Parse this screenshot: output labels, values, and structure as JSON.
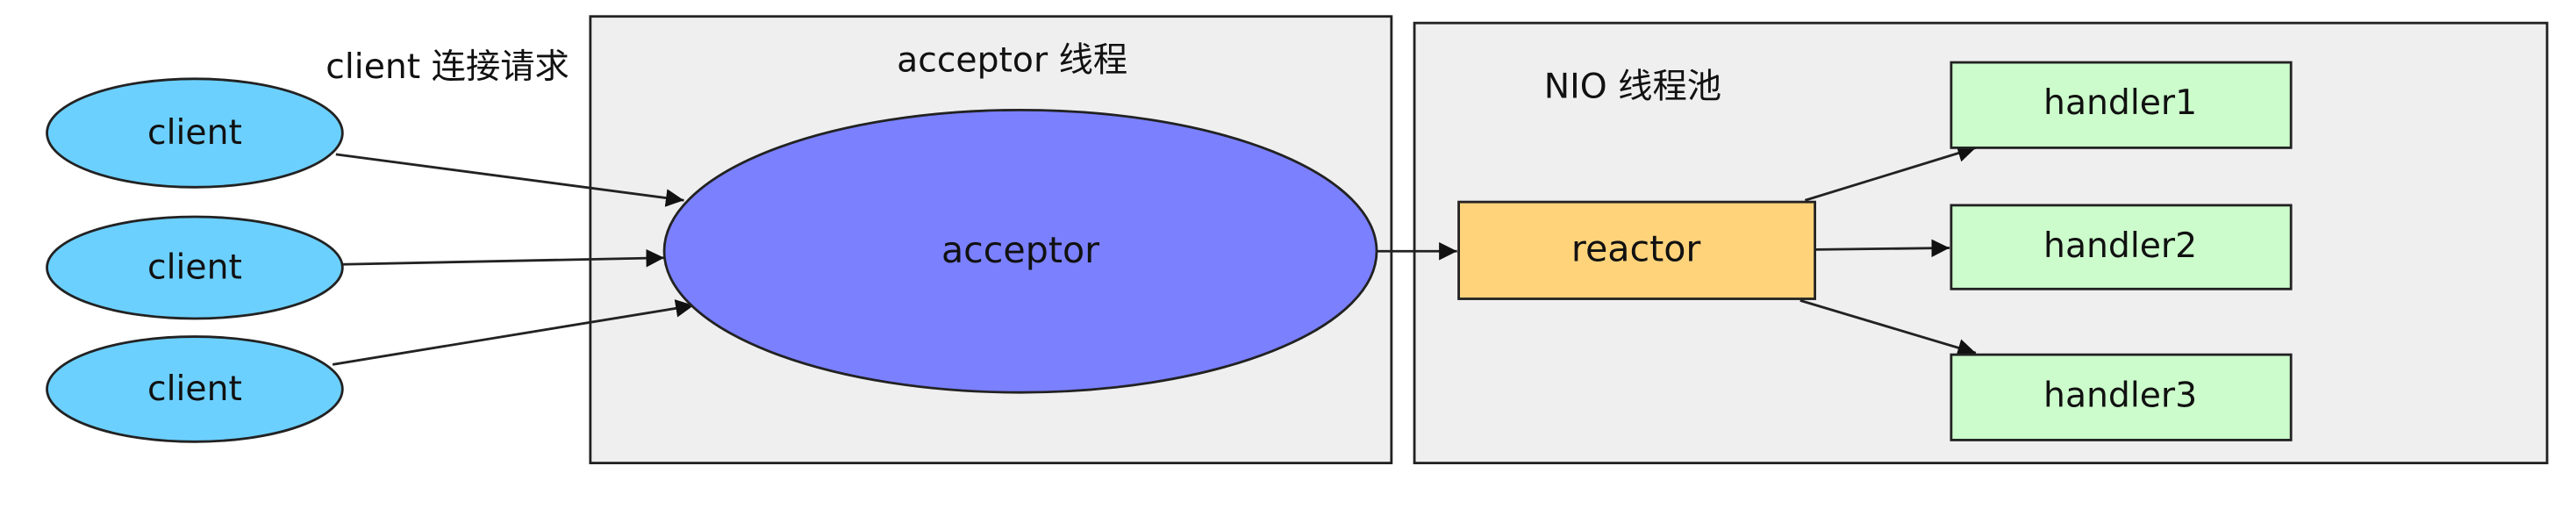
{
  "labels": {
    "client_request": "client 连接请求",
    "acceptor_thread": "acceptor 线程",
    "nio_pool": "NIO 线程池"
  },
  "clients": [
    "client",
    "client",
    "client"
  ],
  "acceptor": "acceptor",
  "reactor": "reactor",
  "handlers": [
    "handler1",
    "handler2",
    "handler3"
  ],
  "colors": {
    "client_fill": "#6cd0ff",
    "acceptor_fill": "#7b80ff",
    "reactor_fill": "#ffd37a",
    "handler_fill": "#ccfccb",
    "container_fill": "#efefef",
    "stroke": "#222222"
  }
}
